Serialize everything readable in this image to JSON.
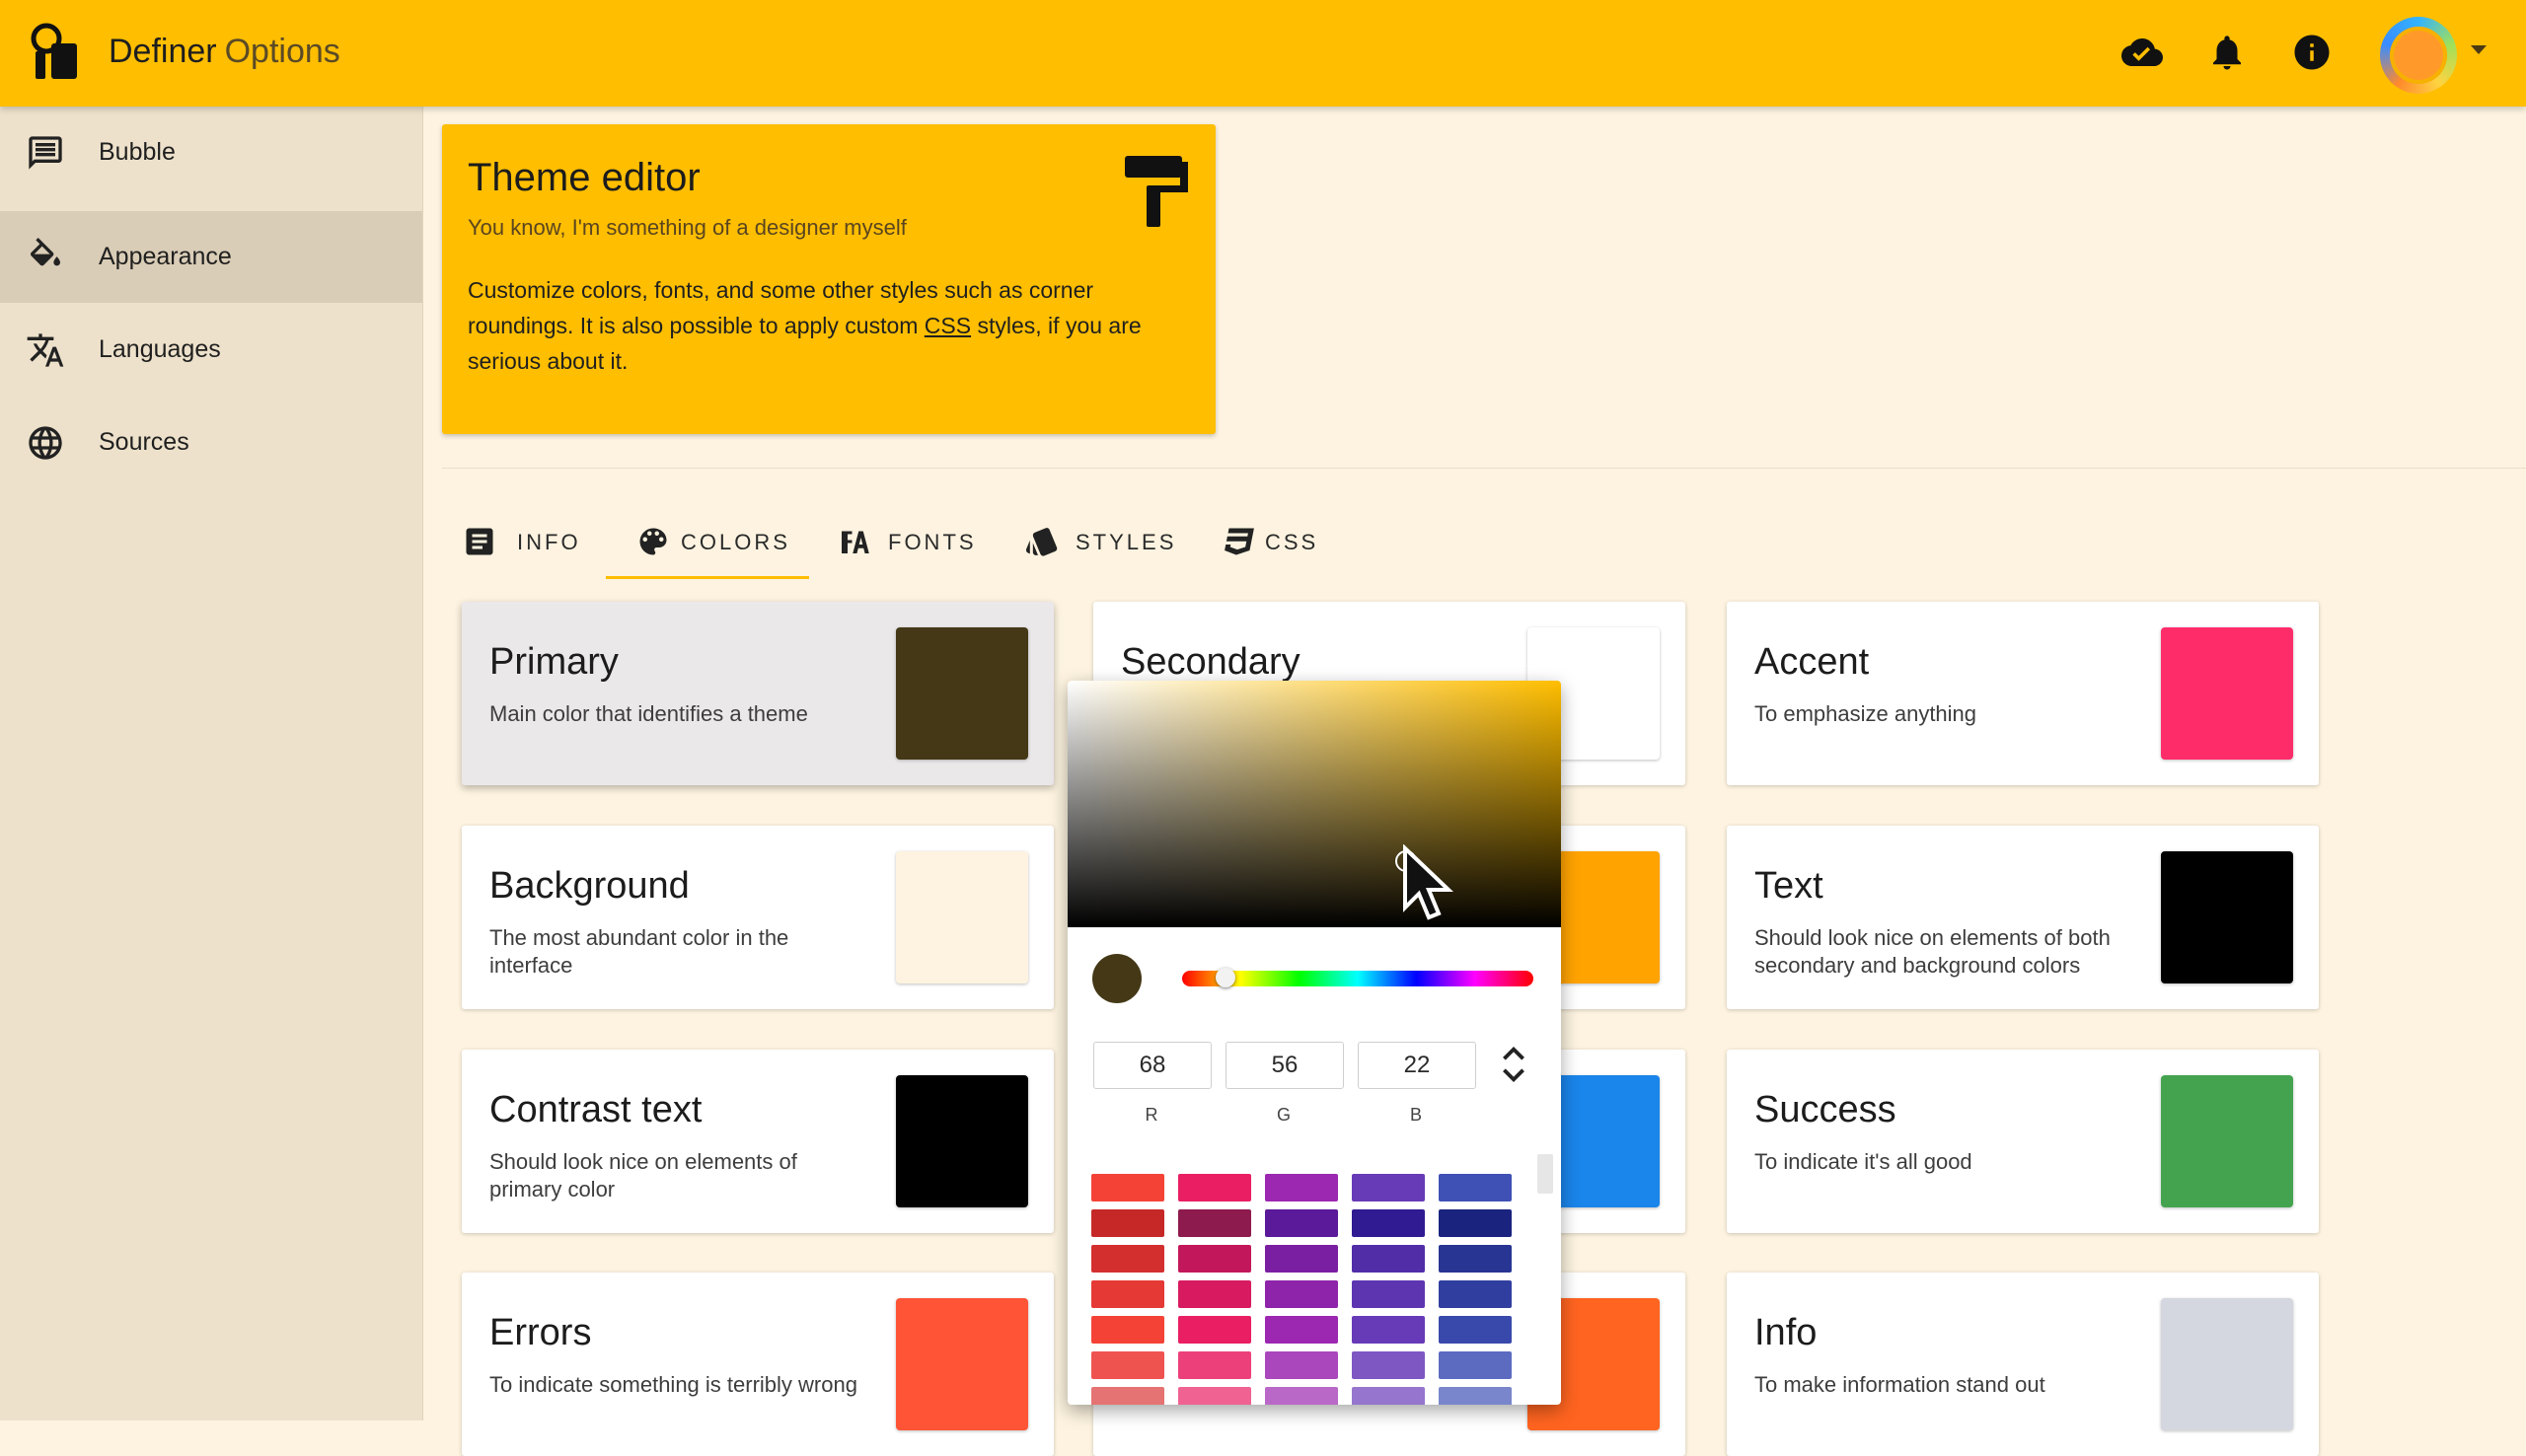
{
  "app": {
    "title": "Definer",
    "subtitle": "Options"
  },
  "topbar": {
    "icons": [
      "cloud-done-icon",
      "bell-icon",
      "info-icon"
    ],
    "accent_color": "#ffbe00"
  },
  "sidebar": {
    "items": [
      {
        "label": "Bubble",
        "icon": "message-icon",
        "active": false
      },
      {
        "label": "Appearance",
        "icon": "paint-bucket-icon",
        "active": true
      },
      {
        "label": "Languages",
        "icon": "translate-icon",
        "active": false
      },
      {
        "label": "Sources",
        "icon": "globe-icon",
        "active": false
      }
    ]
  },
  "hero": {
    "title": "Theme editor",
    "subtitle": "You know, I'm something of a designer myself",
    "body_before": "Customize colors, fonts, and some other styles such as corner roundings. It is also possible to apply custom ",
    "body_link": "CSS",
    "body_after": " styles, if you are serious about it."
  },
  "tabs": [
    {
      "label": "INFO",
      "icon": "document-icon",
      "active": false
    },
    {
      "label": "COLORS",
      "icon": "palette-icon",
      "active": true
    },
    {
      "label": "FONTS",
      "icon": "font-icon",
      "active": false
    },
    {
      "label": "STYLES",
      "icon": "styles-icon",
      "active": false
    },
    {
      "label": "CSS",
      "icon": "css3-icon",
      "active": false
    }
  ],
  "cards": [
    {
      "title": "Primary",
      "desc": "Main color that identifies a theme",
      "color": "#443816"
    },
    {
      "title": "Secondary",
      "desc": "",
      "color": "#ffffff"
    },
    {
      "title": "Accent",
      "desc": "To emphasize anything",
      "color": "#ff2c6a"
    },
    {
      "title": "Background",
      "desc": "The most abundant color in the interface",
      "color": "#fdf3e0"
    },
    {
      "title": "",
      "desc": "",
      "color": "#ffa300"
    },
    {
      "title": "Text",
      "desc": "Should look nice on elements of both secondary and background colors",
      "color": "#000000"
    },
    {
      "title": "Contrast text",
      "desc": "Should look nice on elements of primary color",
      "color": "#000000"
    },
    {
      "title": "",
      "desc": "",
      "color": "#1a85ea"
    },
    {
      "title": "Success",
      "desc": "To indicate it's all good",
      "color": "#44a34f"
    },
    {
      "title": "Errors",
      "desc": "To indicate something is terribly wrong",
      "color": "#ff5436"
    },
    {
      "title": "",
      "desc": "",
      "color": "#ff6420"
    },
    {
      "title": "Info",
      "desc": "To make information stand out",
      "color": "#d4d7df"
    }
  ],
  "picker": {
    "r": "68",
    "g": "56",
    "b": "22",
    "r_label": "R",
    "g_label": "G",
    "b_label": "B",
    "hue_color": "#ffbe00",
    "selected_color": "#443816",
    "palette": [
      [
        "#f44336",
        "#e91e63",
        "#9c27b0",
        "#673ab7",
        "#3f51b5"
      ],
      [
        "#c62828",
        "#8e1b4e",
        "#5b1a99",
        "#311b92",
        "#1a237e"
      ],
      [
        "#d32f2f",
        "#c2185b",
        "#7b1fa2",
        "#512da8",
        "#283593"
      ],
      [
        "#e53935",
        "#d81b60",
        "#8e24aa",
        "#5e35b1",
        "#303f9f"
      ],
      [
        "#f44336",
        "#e91e63",
        "#9c27b0",
        "#673ab7",
        "#3949ab"
      ],
      [
        "#ef5350",
        "#ec407a",
        "#ab47bc",
        "#7e57c2",
        "#5c6bc0"
      ],
      [
        "#e57373",
        "#f06292",
        "#ba68c8",
        "#9575cd",
        "#7986cb"
      ]
    ]
  }
}
